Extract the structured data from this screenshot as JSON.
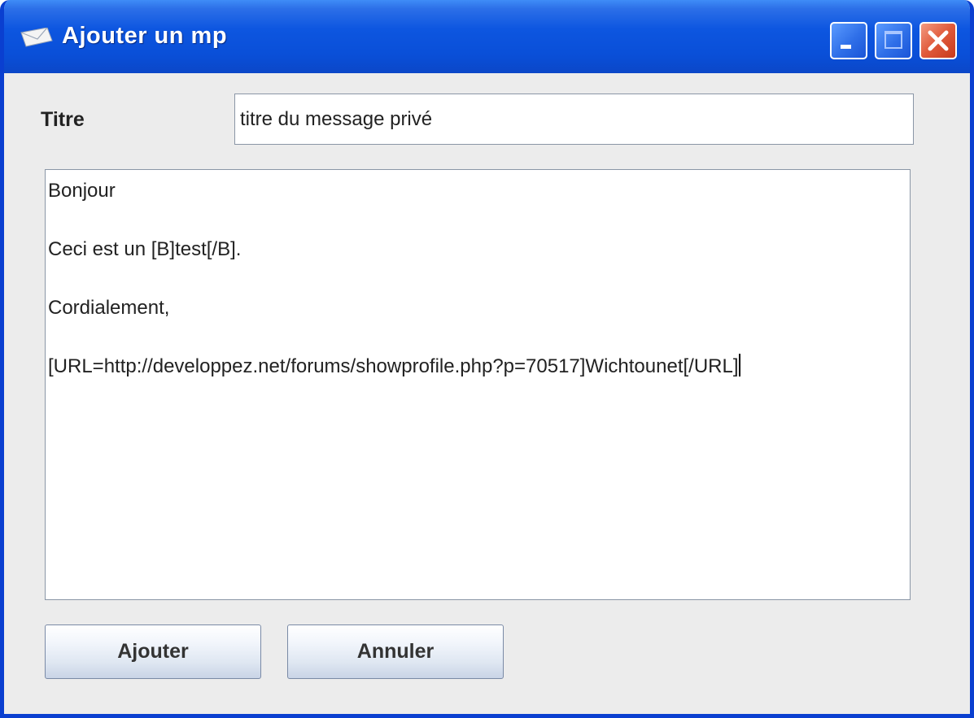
{
  "window": {
    "title": "Ajouter un mp",
    "controls": [
      "minimize",
      "maximize",
      "close"
    ]
  },
  "form": {
    "titre_label": "Titre",
    "titre_value": "titre du message privé",
    "message_value": "Bonjour\n\nCeci est un [B]test[/B].\n\nCordialement,\n\n[URL=http://developpez.net/forums/showprofile.php?p=70517]Wichtounet[/URL]"
  },
  "buttons": {
    "add_label": "Ajouter",
    "cancel_label": "Annuler"
  },
  "icons": {
    "title": "envelope-icon",
    "minimize": "minimize-icon",
    "maximize": "maximize-icon",
    "close": "close-icon"
  },
  "colors": {
    "titlebar": "#0a4fd8",
    "window_bg": "#ececec",
    "close_button": "#e0593a"
  }
}
